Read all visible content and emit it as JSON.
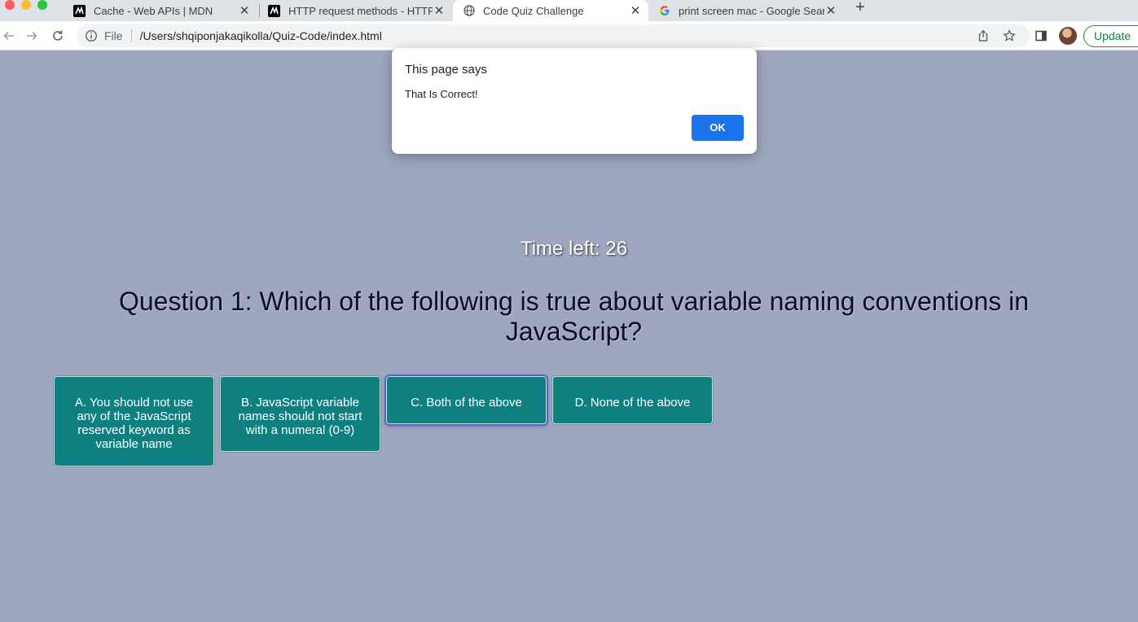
{
  "browser": {
    "tabs": [
      {
        "title": "Cache - Web APIs | MDN",
        "favicon": "mdn-icon",
        "active": false
      },
      {
        "title": "HTTP request methods - HTTP",
        "favicon": "mdn-icon",
        "active": false
      },
      {
        "title": "Code Quiz Challenge",
        "favicon": "globe-icon",
        "active": true
      },
      {
        "title": "print screen mac - Google Search",
        "favicon": "google-icon",
        "active": false
      }
    ],
    "new_tab": "+",
    "close_glyph": "✕",
    "address": {
      "scheme": "File",
      "url": "/Users/shqiponjakaqikolla/Quiz-Code/index.html"
    },
    "update_label": "Update"
  },
  "quiz": {
    "timer": "Time left: 26",
    "question": "Question 1: Which of the following is true about variable naming conventions in JavaScript?",
    "answers": [
      {
        "label": "A. You should not use any of the JavaScript reserved keyword as variable name"
      },
      {
        "label": "B. JavaScript variable names should not start with a numeral (0-9)"
      },
      {
        "label": "C. Both of the above"
      },
      {
        "label": "D. None of the above"
      }
    ]
  },
  "dialog": {
    "title": "This page says",
    "message": "That Is Correct!",
    "ok_label": "OK"
  },
  "colors": {
    "page_background": "#9ea7bf",
    "answer_button": "#0e8080",
    "dialog_ok": "#1a73e8",
    "update_green": "#188038"
  }
}
